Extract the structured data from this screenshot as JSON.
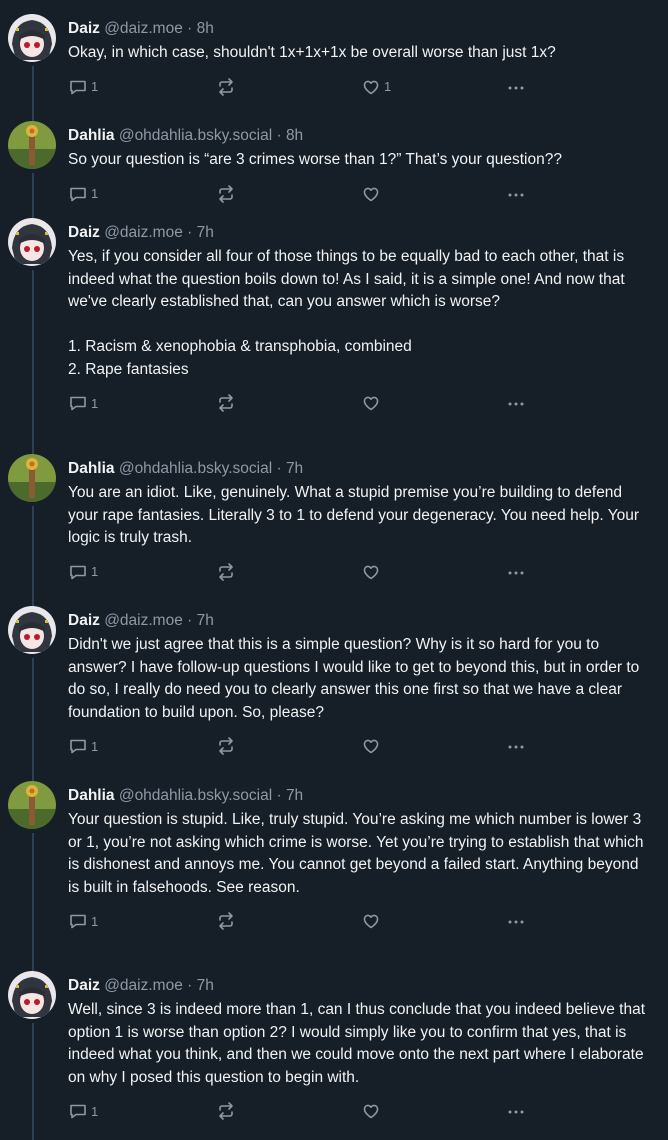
{
  "posts": [
    {
      "author": "Daiz",
      "handle": "@daiz.moe",
      "time": "8h",
      "avatar": "daiz",
      "text": "Okay, in which case, shouldn't 1x+1x+1x be overall worse than just 1x?",
      "replies": "1",
      "likes": "1"
    },
    {
      "author": "Dahlia",
      "handle": "@ohdahlia.bsky.social",
      "time": "8h",
      "avatar": "dahlia",
      "text": "So your question is “are 3 crimes worse than 1?” That’s your question??",
      "replies": "1",
      "likes": ""
    },
    {
      "author": "Daiz",
      "handle": "@daiz.moe",
      "time": "7h",
      "avatar": "daiz",
      "text": "Yes, if you consider all four of those things to be equally bad to each other, that is indeed what the question boils down to! As I said, it is a simple one! And now that we've clearly established that, can you answer which is worse?\n\n1. Racism & xenophobia & transphobia, combined\n2. Rape fantasies",
      "replies": "1",
      "likes": ""
    },
    {
      "author": "Dahlia",
      "handle": "@ohdahlia.bsky.social",
      "time": "7h",
      "avatar": "dahlia",
      "text": "You are an idiot. Like, genuinely. What a stupid premise you’re building to defend your rape fantasies. Literally 3 to 1 to defend your degeneracy. You need help. Your logic is truly trash.",
      "replies": "1",
      "likes": ""
    },
    {
      "author": "Daiz",
      "handle": "@daiz.moe",
      "time": "7h",
      "avatar": "daiz",
      "text": "Didn't we just agree that this is a simple question? Why is it so hard for you to answer? I have follow-up questions I would like to get to beyond this, but in order to do so, I really do need you to clearly answer this one first so that we have a clear foundation to build upon. So, please?",
      "replies": "1",
      "likes": ""
    },
    {
      "author": "Dahlia",
      "handle": "@ohdahlia.bsky.social",
      "time": "7h",
      "avatar": "dahlia",
      "text": "Your question is stupid. Like, truly stupid. You’re asking me which number is lower 3 or 1, you’re not asking which crime is worse. Yet you’re trying to establish that which is dishonest and annoys me. You cannot get beyond a failed start. Anything beyond is built in falsehoods. See reason.",
      "replies": "1",
      "likes": ""
    },
    {
      "author": "Daiz",
      "handle": "@daiz.moe",
      "time": "7h",
      "avatar": "daiz",
      "text": "Well, since 3 is indeed more than 1, can I thus conclude that you indeed believe that option 1 is worse than option 2? I would simply like you to confirm that yes, that is indeed what you think, and then we could move onto the next part where I elaborate on why I posed this question to begin with.",
      "replies": "1",
      "likes": ""
    }
  ],
  "icons": {
    "reply": "reply-icon",
    "repost": "repost-icon",
    "like": "heart-icon",
    "more": "more-icon"
  },
  "separator": "·"
}
